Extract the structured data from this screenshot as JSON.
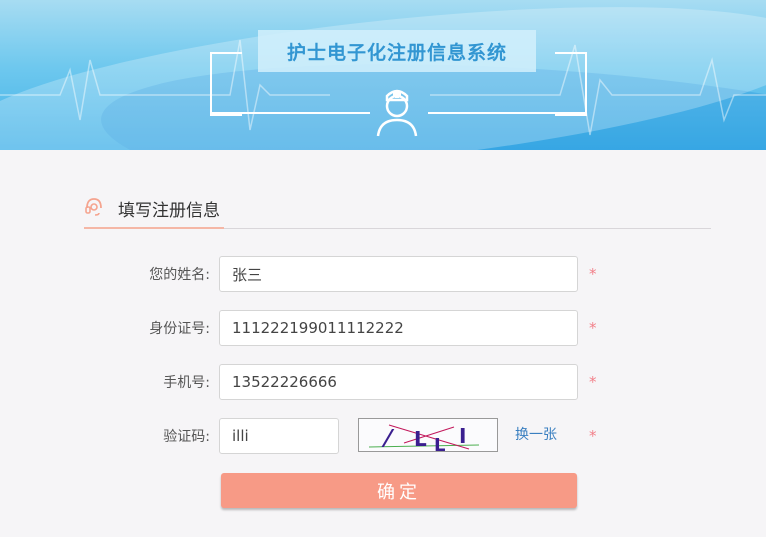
{
  "app": {
    "title": "护士电子化注册信息系统"
  },
  "section": {
    "title": "填写注册信息"
  },
  "form": {
    "name": {
      "label": "您的姓名:",
      "value": "张三"
    },
    "id_number": {
      "label": "身份证号:",
      "value": "11122219901111​2222"
    },
    "phone": {
      "label": "手机号:",
      "value": "13522226666"
    },
    "captcha": {
      "label": "验证码:",
      "value": "illi",
      "refresh_label": "换一张"
    },
    "required_mark": "*",
    "submit_label": "确定"
  },
  "colors": {
    "banner_blue": "#3fb0e8",
    "title_text": "#3296d2",
    "accent_salmon": "#f79a86",
    "required_red": "#f2818a",
    "link_blue": "#3a7fc0"
  },
  "icons": {
    "banner": "nurse-icon",
    "section": "headset-icon"
  }
}
